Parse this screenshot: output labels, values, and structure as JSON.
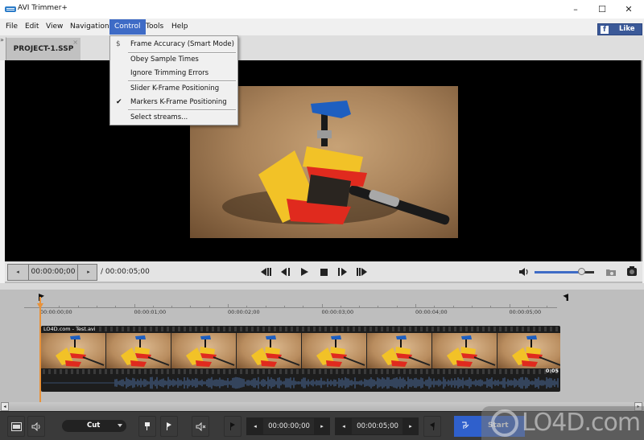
{
  "window": {
    "title": "AVI Trimmer+",
    "minimize_glyph": "–",
    "maximize_glyph": "☐",
    "close_glyph": "✕"
  },
  "menubar": {
    "items": [
      {
        "label": "File"
      },
      {
        "label": "Edit"
      },
      {
        "label": "View"
      },
      {
        "label": "Navigation"
      },
      {
        "label": "Control",
        "active": true
      },
      {
        "label": "Tools"
      },
      {
        "label": "Help"
      }
    ]
  },
  "facebook": {
    "icon": "f",
    "label": "Like",
    "color": "#3b5998"
  },
  "tabs": {
    "chevron": "»",
    "project_tab": {
      "label": "PROJECT-1.SSP",
      "close_glyph": "×"
    }
  },
  "control_menu": {
    "items": [
      {
        "label": "Frame Accuracy (Smart Mode)",
        "icon": "dollar-icon",
        "checked": false
      },
      {
        "separator": true
      },
      {
        "label": "Obey Sample Times",
        "checked": false
      },
      {
        "label": "Ignore Trimming Errors",
        "checked": false
      },
      {
        "separator": true
      },
      {
        "label": "Slider K-Frame Positioning",
        "checked": false
      },
      {
        "label": "Markers K-Frame Positioning",
        "checked": true
      },
      {
        "separator": true
      },
      {
        "label": "Select streams...",
        "checked": false
      }
    ],
    "check_glyph": "✔",
    "icon_glyph": "$"
  },
  "player": {
    "current_time": "00:00:00;00",
    "total_time": "/ 00:00:05;00",
    "prev_arrow": "◂",
    "next_arrow": "▸",
    "volume_level": 0.78
  },
  "timeline": {
    "ticks": [
      {
        "label": "00:00:00;00",
        "seconds": 0
      },
      {
        "label": "00:00:01;00",
        "seconds": 1
      },
      {
        "label": "00:00:02;00",
        "seconds": 2
      },
      {
        "label": "00:00:03;00",
        "seconds": 3
      },
      {
        "label": "00:00:04;00",
        "seconds": 4
      },
      {
        "label": "00:00:05;00",
        "seconds": 5
      }
    ],
    "duration_seconds": 5,
    "playhead_seconds": 0,
    "end_marker_seconds": 5.6,
    "clip": {
      "name": "LO4D.com - Test.avi",
      "duration": "0:05",
      "thumbnail_count": 8
    },
    "accent_color": "#e8923a"
  },
  "scrollbar": {
    "left_arrow": "◂",
    "right_arrow": "▸"
  },
  "bottom_toolbar": {
    "mode_select": "Cut",
    "start_time": "00:00:00;00",
    "end_time": "00:00:05;00",
    "start_button": "Start",
    "prev_arrow": "◂",
    "next_arrow": "▸",
    "accent_color": "#2f60cc"
  },
  "watermark": {
    "text": "LO4D.com"
  }
}
